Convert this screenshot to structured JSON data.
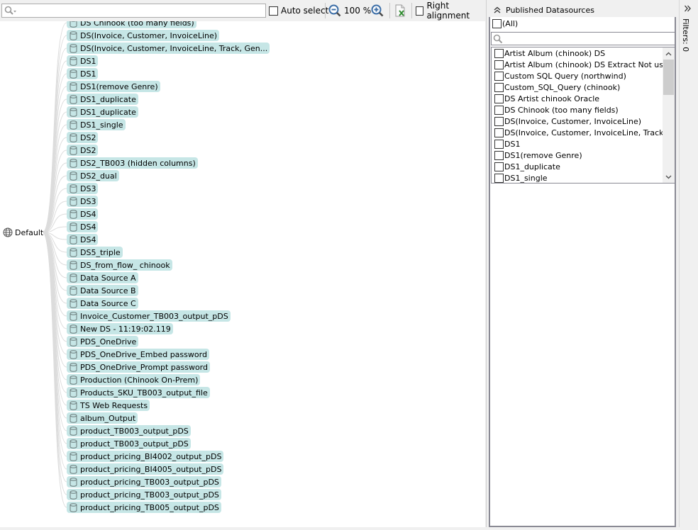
{
  "toolbar": {
    "search_placeholder": "",
    "auto_select_label": "Auto select",
    "auto_select_checked": false,
    "zoom_level": "100 %",
    "right_alignment_label": "Right alignment",
    "right_alignment_checked": false,
    "icons": {
      "search": "magnifier-dropdown-icon",
      "zoom_out": "zoom-out-icon",
      "zoom_in": "zoom-in-icon",
      "export": "export-excel-icon"
    }
  },
  "tree": {
    "root_label": "Default",
    "root_icon": "globe-icon",
    "node_icon": "database-icon",
    "node_color": "#c6e6e6",
    "nodes": [
      "DS Chinook (too many fields)",
      "DS(Invoice, Customer, InvoiceLine)",
      "DS(Invoice, Customer, InvoiceLine, Track, Gen...",
      "DS1",
      "DS1",
      "DS1(remove Genre)",
      "DS1_duplicate",
      "DS1_duplicate",
      "DS1_single",
      "DS2",
      "DS2",
      "DS2_TB003 (hidden columns)",
      "DS2_dual",
      "DS3",
      "DS3",
      "DS4",
      "DS4",
      "DS4",
      "DS5_triple",
      "DS_from_flow_ chinook",
      "Data Source A",
      "Data Source B",
      "Data Source C",
      "Invoice_Customer_TB003_output_pDS",
      "New DS - 11:19:02.119",
      "PDS_OneDrive",
      "PDS_OneDrive_Embed password",
      "PDS_OneDrive_Prompt password",
      "Production (Chinook On-Prem)",
      "Products_SKU_TB003_output_file",
      "TS Web Requests",
      "album_Output",
      "product_TB003_output_pDS",
      "product_TB003_output_pDS",
      "product_pricing_BI4002_output_pDS",
      "product_pricing_BI4005_output_pDS",
      "product_pricing_TB003_output_pDS",
      "product_pricing_TB003_output_pDS",
      "product_pricing_TB005_output_pDS"
    ]
  },
  "filter_panel": {
    "title": "Published Datasources",
    "collapse_icon": "double-chevron-up-icon",
    "all_label": "(All)",
    "all_checked": false,
    "search_placeholder": "",
    "items": [
      {
        "label": "Artist Album (chinook) DS",
        "checked": false
      },
      {
        "label": "Artist Album (chinook) DS Extract Not used",
        "checked": false
      },
      {
        "label": "Custom SQL Query (northwind)",
        "checked": false
      },
      {
        "label": "Custom_SQL_Query (chinook)",
        "checked": false
      },
      {
        "label": "DS Artist chinook Oracle",
        "checked": false
      },
      {
        "label": "DS Chinook (too many fields)",
        "checked": false
      },
      {
        "label": "DS(Invoice, Customer, InvoiceLine)",
        "checked": false
      },
      {
        "label": "DS(Invoice, Customer, InvoiceLine, Track, ...",
        "checked": false
      },
      {
        "label": "DS1",
        "checked": false
      },
      {
        "label": "DS1(remove Genre)",
        "checked": false
      },
      {
        "label": "DS1_duplicate",
        "checked": false
      },
      {
        "label": "DS1_single",
        "checked": false
      }
    ]
  },
  "filters_strip": {
    "label": "Filters: 0",
    "expand_icon": "double-chevron-right-icon"
  }
}
